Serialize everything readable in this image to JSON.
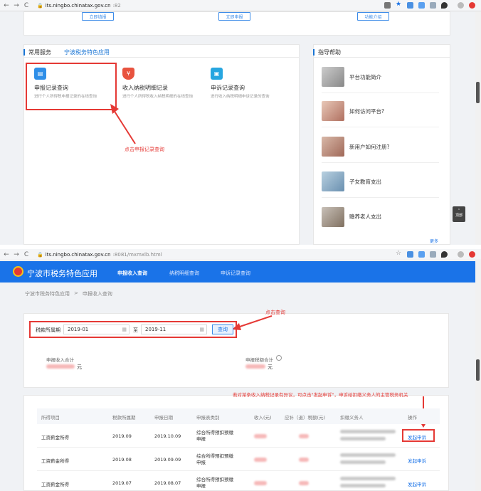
{
  "top": {
    "url_host": "its.ningbo.chinatax.gov.cn",
    "url_path": ":82",
    "buttons": [
      "立即填报",
      "立即申报",
      "功能介绍"
    ],
    "section_tab1": "常用服务",
    "section_tab2": "宁波税务特色应用",
    "help_title": "指导帮助",
    "services": [
      {
        "title": "申报记录查询",
        "desc": "进行个人所得税申报记录的在线查询",
        "color": "#2f8fe8"
      },
      {
        "title": "收入纳税明细记录",
        "desc": "进行个人所得税收入纳税明细的在线查询",
        "color": "#e8533f"
      },
      {
        "title": "申诉记录查询",
        "desc": "进行收入纳税明细申诉记录的查询",
        "color": "#27a6e0"
      }
    ],
    "annotation": "点击申报记录查询",
    "help_items": [
      "平台功能简介",
      "如何访问平台?",
      "新用户如何注册?",
      "子女教育支出",
      "赡养老人支出"
    ],
    "more": "更多",
    "top_button": "顶部"
  },
  "bottom": {
    "url_host": "its.ningbo.chinatax.gov.cn",
    "url_path": ":8081/mxmxlb.html",
    "brand": "宁波市税务特色应用",
    "nav": [
      "申报收入查询",
      "纳税明细查询",
      "申诉记录查询"
    ],
    "breadcrumb_home": "宁波市税务特色应用",
    "breadcrumb_sep": ">",
    "breadcrumb_current": "申报收入查询",
    "annot_query": "点击查询",
    "period_label": "税款所属期",
    "from": "2019-01",
    "to_sep": "至",
    "to": "2019-11",
    "query_btn": "查询",
    "sum_income_label": "申报收入合计",
    "sum_tax_label": "申报税额合计",
    "unit": "元",
    "annot_appeal": "若对某条收入纳税记录有异议，可点击\"发起申诉\"，申诉给扣缴义务人的主管税务机关",
    "headers": [
      "所得项目",
      "税款所属期",
      "申报日期",
      "申报表类别",
      "收入(元)",
      "应补（退）税额(元)",
      "扣缴义务人",
      "操作"
    ],
    "rows": [
      {
        "item": "工资薪金所得",
        "period": "2019.09",
        "date": "2019.10.09",
        "type": "综合所得预扣预缴申报",
        "op": "发起申诉"
      },
      {
        "item": "工资薪金所得",
        "period": "2019.08",
        "date": "2019.09.09",
        "type": "综合所得预扣预缴申报",
        "op": "发起申诉"
      },
      {
        "item": "工资薪金所得",
        "period": "2019.07",
        "date": "2019.08.07",
        "type": "综合所得预扣预缴申报",
        "op": "发起申诉"
      }
    ]
  }
}
